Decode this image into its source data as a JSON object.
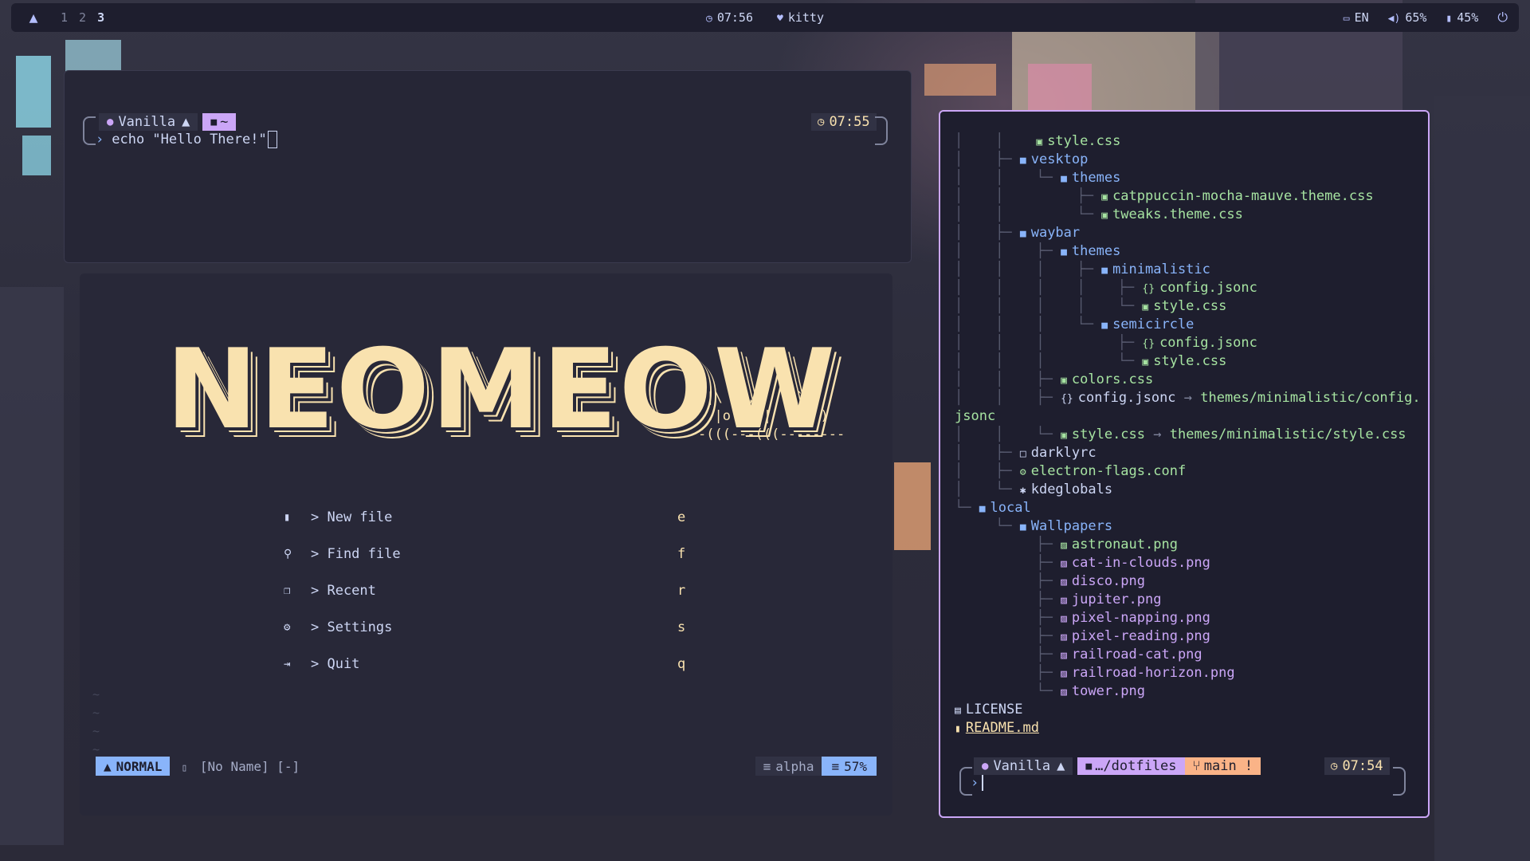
{
  "topbar": {
    "workspaces": [
      "1",
      "2",
      "3"
    ],
    "active_workspace": "3",
    "time": "07:56",
    "app": "kitty",
    "language": "EN",
    "volume": "65%",
    "battery": "45%",
    "icons": {
      "logo": "arch-logo-icon",
      "clock": "clock-icon",
      "app": "cat-icon",
      "keyboard": "keyboard-icon",
      "volume": "volume-icon",
      "battery": "battery-icon",
      "power": "power-icon"
    }
  },
  "terminal_top": {
    "user": "Vanilla",
    "dir": "~",
    "command": "echo \"Hello There!\"",
    "time": "07:55"
  },
  "neovim": {
    "title": "NEOMEOW",
    "cat_art": " |\\  /,|   (`\\\n .|o o  |    ) )\n-(((---(((--------",
    "menu": [
      {
        "icon": "file-icon",
        "label": "> New file",
        "key": "e"
      },
      {
        "icon": "search-icon",
        "label": "> Find file",
        "key": "f"
      },
      {
        "icon": "copy-icon",
        "label": "> Recent",
        "key": "r"
      },
      {
        "icon": "gears-icon",
        "label": "> Settings",
        "key": "s"
      },
      {
        "icon": "exit-icon",
        "label": "> Quit",
        "key": "q"
      }
    ],
    "status": {
      "mode": "NORMAL",
      "file": "[No Name] [-]",
      "filetype": "alpha",
      "percent": "57%"
    }
  },
  "file_tree": {
    "lines": [
      {
        "guide": "│    │    ",
        "icon": "▣",
        "name": "style.css",
        "cls": "css"
      },
      {
        "guide": "│    ├─ ",
        "icon": "■",
        "name": "vesktop",
        "cls": "dir"
      },
      {
        "guide": "│    │    └─ ",
        "icon": "■",
        "name": "themes",
        "cls": "dir"
      },
      {
        "guide": "│    │         ├─ ",
        "icon": "▣",
        "name": "catppuccin-mocha-mauve.theme.css",
        "cls": "css"
      },
      {
        "guide": "│    │         └─ ",
        "icon": "▣",
        "name": "tweaks.theme.css",
        "cls": "css"
      },
      {
        "guide": "│    ├─ ",
        "icon": "■",
        "name": "waybar",
        "cls": "dir"
      },
      {
        "guide": "│    │    ├─ ",
        "icon": "■",
        "name": "themes",
        "cls": "dir"
      },
      {
        "guide": "│    │    │    ├─ ",
        "icon": "■",
        "name": "minimalistic",
        "cls": "dir"
      },
      {
        "guide": "│    │    │    │    ├─ ",
        "icon": "{}",
        "name": "config.jsonc",
        "cls": "json"
      },
      {
        "guide": "│    │    │    │    └─ ",
        "icon": "▣",
        "name": "style.css",
        "cls": "css"
      },
      {
        "guide": "│    │    │    └─ ",
        "icon": "■",
        "name": "semicircle",
        "cls": "dir"
      },
      {
        "guide": "│    │    │         ├─ ",
        "icon": "{}",
        "name": "config.jsonc",
        "cls": "json"
      },
      {
        "guide": "│    │    │         └─ ",
        "icon": "▣",
        "name": "style.css",
        "cls": "css"
      },
      {
        "guide": "│    │    ├─ ",
        "icon": "▣",
        "name": "colors.css",
        "cls": "css"
      },
      {
        "guide": "│    │    ├─ ",
        "icon": "{}",
        "name": "config.jsonc",
        "cls": "plain",
        "link": "themes/minimalistic/config."
      },
      {
        "guide": "",
        "icon": "",
        "name": "jsonc",
        "cls": "arrowtgt"
      },
      {
        "guide": "│    │    └─ ",
        "icon": "▣",
        "name": "style.css",
        "cls": "css",
        "link": "themes/minimalistic/style.css"
      },
      {
        "guide": "│    ├─ ",
        "icon": "□",
        "name": "darklyrc",
        "cls": "plain"
      },
      {
        "guide": "│    ├─ ",
        "icon": "⚙",
        "name": "electron-flags.conf",
        "cls": "css"
      },
      {
        "guide": "│    └─ ",
        "icon": "✱",
        "name": "kdeglobals",
        "cls": "plain"
      },
      {
        "guide": "└─ ",
        "icon": "■",
        "name": "local",
        "cls": "dir"
      },
      {
        "guide": "     └─ ",
        "icon": "■",
        "name": "Wallpapers",
        "cls": "dir"
      },
      {
        "guide": "          ├─ ",
        "icon": "▨",
        "name": "astronaut.png",
        "cls": "css"
      },
      {
        "guide": "          ├─ ",
        "icon": "▨",
        "name": "cat-in-clouds.png",
        "cls": "png"
      },
      {
        "guide": "          ├─ ",
        "icon": "▨",
        "name": "disco.png",
        "cls": "png"
      },
      {
        "guide": "          ├─ ",
        "icon": "▨",
        "name": "jupiter.png",
        "cls": "png"
      },
      {
        "guide": "          ├─ ",
        "icon": "▨",
        "name": "pixel-napping.png",
        "cls": "png"
      },
      {
        "guide": "          ├─ ",
        "icon": "▨",
        "name": "pixel-reading.png",
        "cls": "png"
      },
      {
        "guide": "          ├─ ",
        "icon": "▨",
        "name": "railroad-cat.png",
        "cls": "png"
      },
      {
        "guide": "          ├─ ",
        "icon": "▨",
        "name": "railroad-horizon.png",
        "cls": "png"
      },
      {
        "guide": "          └─ ",
        "icon": "▨",
        "name": "tower.png",
        "cls": "png"
      },
      {
        "guide": "",
        "icon": "▤",
        "name": "LICENSE",
        "cls": "plain"
      },
      {
        "guide": "",
        "icon": "▮",
        "name": "README.md",
        "cls": "readme"
      }
    ]
  },
  "terminal_right": {
    "user": "Vanilla",
    "dir": "…/dotfiles",
    "branch": "main !",
    "time": "07:54"
  },
  "colors": {
    "mauve": "#cba6f7",
    "blue": "#89b4fa",
    "green": "#a6e3a1",
    "yellow": "#f9e2af",
    "peach": "#fab387",
    "base": "#1e1e2e"
  }
}
